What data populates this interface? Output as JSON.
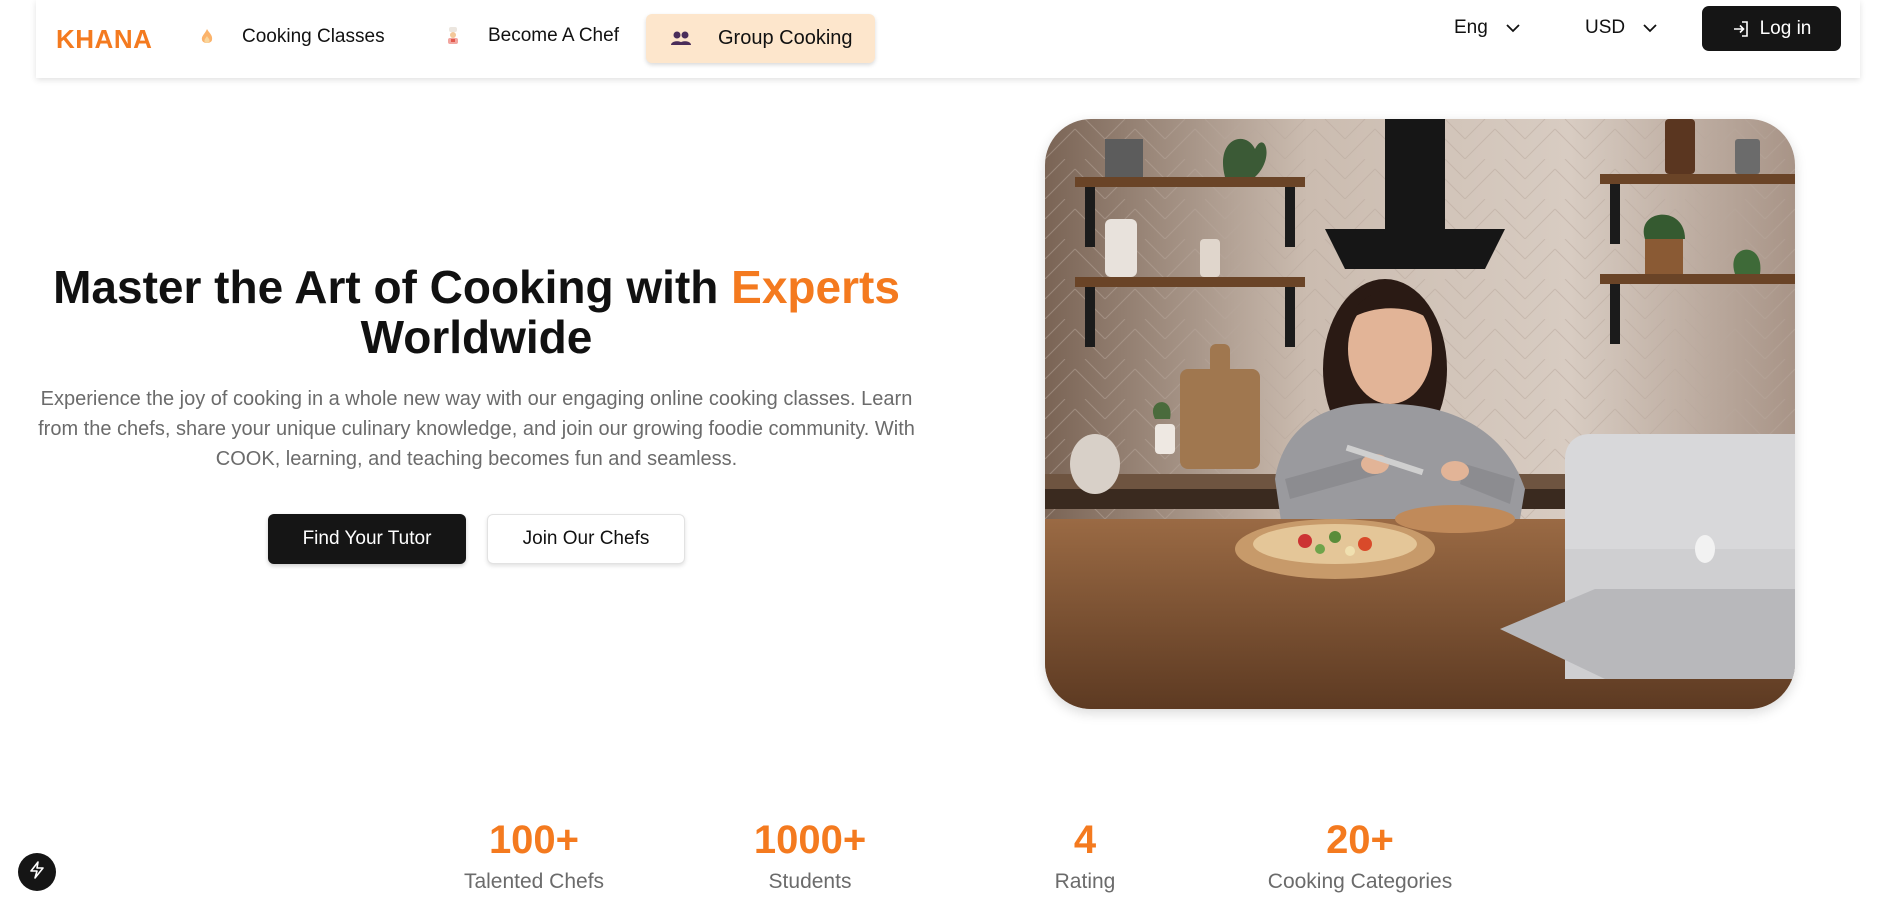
{
  "brand": {
    "logo_text": "KHANA",
    "accent_color": "#f47a1f"
  },
  "nav": {
    "items": [
      {
        "label": "Cooking Classes",
        "icon": "flame-icon"
      },
      {
        "label": "Become A Chef",
        "icon": "chef-icon"
      },
      {
        "label": "Group Cooking",
        "icon": "group-icon",
        "active": true
      }
    ],
    "language": {
      "selected": "Eng",
      "icon": "chevron-down-icon"
    },
    "currency": {
      "selected": "USD",
      "icon": "chevron-down-icon"
    },
    "login": {
      "label": "Log in",
      "icon": "login-icon"
    }
  },
  "hero": {
    "title_main": "Master the Art of Cooking with ",
    "title_accent": "Experts",
    "title_end": "Worldwide",
    "description": "Experience the joy of cooking in a whole new way with our engaging online cooking classes. Learn from the chefs, share your unique culinary knowledge, and join our growing foodie community. With COOK, learning, and teaching becomes fun and seamless.",
    "primary_button": "Find Your Tutor",
    "secondary_button": "Join Our Chefs"
  },
  "stats": [
    {
      "value": "100+",
      "label": "Talented Chefs"
    },
    {
      "value": "1000+",
      "label": "Students"
    },
    {
      "value": "4",
      "label": "Rating"
    },
    {
      "value": "20+",
      "label": "Cooking Categories"
    }
  ],
  "floating_button": {
    "icon": "lightning-icon"
  }
}
